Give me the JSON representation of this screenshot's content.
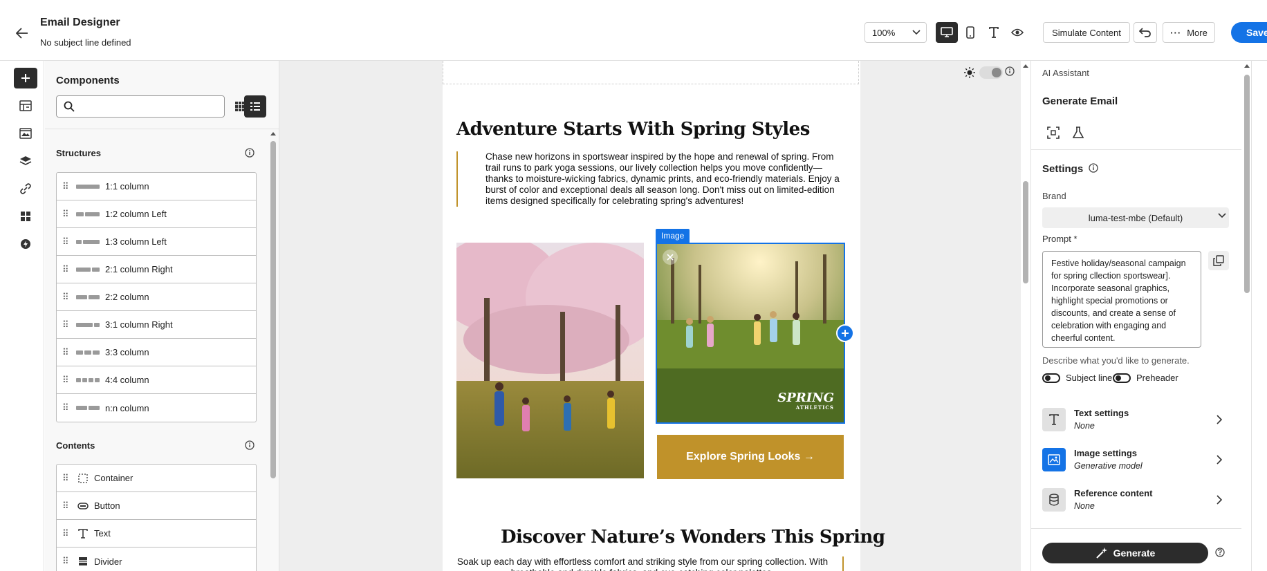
{
  "header": {
    "title": "Email Designer",
    "subtitle": "No subject line defined",
    "zoom": "100%",
    "simulate_label": "Simulate Content",
    "more_label": "More",
    "save_label": "Save"
  },
  "components": {
    "title": "Components",
    "search_placeholder": "",
    "structures_label": "Structures",
    "structures": [
      {
        "label": "1:1 column",
        "cols": [
          1
        ]
      },
      {
        "label": "1:2 column Left",
        "cols": [
          1,
          2
        ]
      },
      {
        "label": "1:3 column Left",
        "cols": [
          1,
          3
        ]
      },
      {
        "label": "2:1 column Right",
        "cols": [
          2,
          1
        ]
      },
      {
        "label": "2:2 column",
        "cols": [
          1,
          1
        ]
      },
      {
        "label": "3:1 column Right",
        "cols": [
          3,
          1
        ]
      },
      {
        "label": "3:3 column",
        "cols": [
          1,
          1,
          1
        ]
      },
      {
        "label": "4:4 column",
        "cols": [
          1,
          1,
          1,
          1
        ]
      },
      {
        "label": "n:n column",
        "cols": [
          1,
          1
        ]
      }
    ],
    "contents_label": "Contents",
    "contents": [
      {
        "label": "Container",
        "icon": "container-icon"
      },
      {
        "label": "Button",
        "icon": "button-icon"
      },
      {
        "label": "Text",
        "icon": "text-icon"
      },
      {
        "label": "Divider",
        "icon": "divider-icon"
      }
    ]
  },
  "email": {
    "heading1": "Adventure Starts With Spring Styles",
    "intro": "Chase new horizons in sportswear inspired by the hope and renewal of spring. From trail runs to park yoga sessions, our lively collection helps you move confidently—thanks to moisture-wicking fabrics, dynamic prints, and eco-friendly materials. Enjoy a burst of color and exceptional deals all season long. Don't miss out on limited-edition items designed specifically for celebrating spring's adventures!",
    "image_tag": "Image",
    "logo_text": "SPRING",
    "logo_sub": "ATHLETICS",
    "cta": "Explore Spring Looks →",
    "heading2": "Discover Nature’s Wonders This Spring",
    "outro": "Soak up each day with effortless comfort and striking style from our spring collection. With breathable and durable fabrics, and eye-catching color palettes."
  },
  "assistant": {
    "section_label": "AI Assistant",
    "title": "Generate Email",
    "settings_label": "Settings",
    "brand_label": "Brand",
    "brand_value": "luma-test-mbe (Default)",
    "prompt_label": "Prompt *",
    "prompt_text": "Festive holiday/seasonal campaign for spring cllection sportswear]. Incorporate seasonal graphics, highlight special promotions or discounts, and create a sense of celebration with engaging and cheerful content.",
    "prompt_help": "Describe what you'd like to generate.",
    "subject_toggle": "Subject line",
    "preheader_toggle": "Preheader",
    "text_settings": {
      "name": "Text settings",
      "value": "None"
    },
    "image_settings": {
      "name": "Image settings",
      "value": "Generative model"
    },
    "reference_content": {
      "name": "Reference content",
      "value": "None"
    },
    "generate_label": "Generate"
  },
  "colors": {
    "accent": "#1473e6",
    "gold": "#c0922a",
    "dark": "#2c2c2c"
  }
}
